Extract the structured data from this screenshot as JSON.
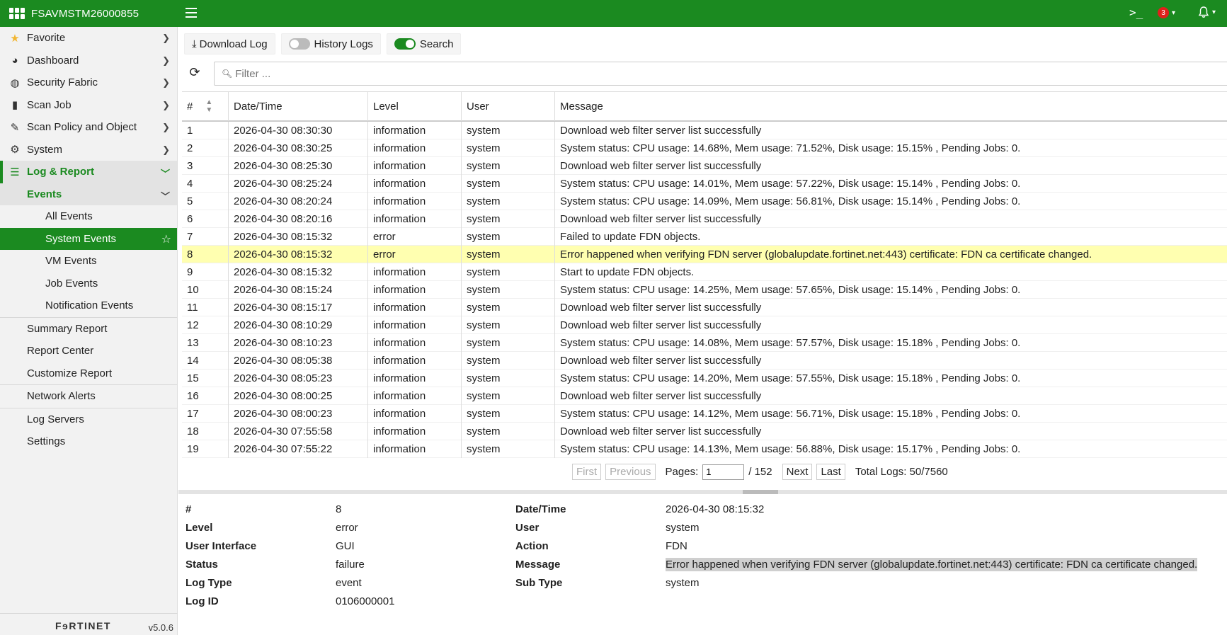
{
  "app": {
    "hostname": "FSAVMSTM26000855",
    "version": "v5.0.6",
    "brand": "FɘRTINET",
    "alert_count": "3",
    "accent": "#1b8a20"
  },
  "sidebar": {
    "items": [
      {
        "label": "Favorite",
        "icon": "star-icon"
      },
      {
        "label": "Dashboard",
        "icon": "dashboard-icon"
      },
      {
        "label": "Security Fabric",
        "icon": "fabric-icon"
      },
      {
        "label": "Scan Job",
        "icon": "file-icon"
      },
      {
        "label": "Scan Policy and Object",
        "icon": "edit-icon"
      },
      {
        "label": "System",
        "icon": "gear-icon"
      },
      {
        "label": "Log & Report",
        "icon": "chart-icon"
      }
    ],
    "events_label": "Events",
    "events_items": [
      "All Events",
      "System Events",
      "VM Events",
      "Job Events",
      "Notification Events"
    ],
    "report_items": [
      "Summary Report",
      "Report Center",
      "Customize Report"
    ],
    "network_alerts": "Network Alerts",
    "bottom_items": [
      "Log Servers",
      "Settings"
    ]
  },
  "toolbar": {
    "download": "Download Log",
    "history": "History Logs",
    "search": "Search"
  },
  "filter": {
    "placeholder": "Filter ..."
  },
  "table": {
    "headers": [
      "#",
      "Date/Time",
      "Level",
      "User",
      "Message"
    ],
    "rows": [
      [
        "1",
        "2026-04-30 08:30:30",
        "information",
        "system",
        "Download web filter server list successfully"
      ],
      [
        "2",
        "2026-04-30 08:30:25",
        "information",
        "system",
        "System status: CPU usage: 14.68%, Mem usage: 71.52%, Disk usage: 15.15% , Pending Jobs: 0."
      ],
      [
        "3",
        "2026-04-30 08:25:30",
        "information",
        "system",
        "Download web filter server list successfully"
      ],
      [
        "4",
        "2026-04-30 08:25:24",
        "information",
        "system",
        "System status: CPU usage: 14.01%, Mem usage: 57.22%, Disk usage: 15.14% , Pending Jobs: 0."
      ],
      [
        "5",
        "2026-04-30 08:20:24",
        "information",
        "system",
        "System status: CPU usage: 14.09%, Mem usage: 56.81%, Disk usage: 15.14% , Pending Jobs: 0."
      ],
      [
        "6",
        "2026-04-30 08:20:16",
        "information",
        "system",
        "Download web filter server list successfully"
      ],
      [
        "7",
        "2026-04-30 08:15:32",
        "error",
        "system",
        "Failed to update FDN objects."
      ],
      [
        "8",
        "2026-04-30 08:15:32",
        "error",
        "system",
        "Error happened when verifying FDN server (globalupdate.fortinet.net:443) certificate: FDN ca certificate changed."
      ],
      [
        "9",
        "2026-04-30 08:15:32",
        "information",
        "system",
        "Start to update FDN objects."
      ],
      [
        "10",
        "2026-04-30 08:15:24",
        "information",
        "system",
        "System status: CPU usage: 14.25%, Mem usage: 57.65%, Disk usage: 15.14% , Pending Jobs: 0."
      ],
      [
        "11",
        "2026-04-30 08:15:17",
        "information",
        "system",
        "Download web filter server list successfully"
      ],
      [
        "12",
        "2026-04-30 08:10:29",
        "information",
        "system",
        "Download web filter server list successfully"
      ],
      [
        "13",
        "2026-04-30 08:10:23",
        "information",
        "system",
        "System status: CPU usage: 14.08%, Mem usage: 57.57%, Disk usage: 15.18% , Pending Jobs: 0."
      ],
      [
        "14",
        "2026-04-30 08:05:38",
        "information",
        "system",
        "Download web filter server list successfully"
      ],
      [
        "15",
        "2026-04-30 08:05:23",
        "information",
        "system",
        "System status: CPU usage: 14.20%, Mem usage: 57.55%, Disk usage: 15.18% , Pending Jobs: 0."
      ],
      [
        "16",
        "2026-04-30 08:00:25",
        "information",
        "system",
        "Download web filter server list successfully"
      ],
      [
        "17",
        "2026-04-30 08:00:23",
        "information",
        "system",
        "System status: CPU usage: 14.12%, Mem usage: 56.71%, Disk usage: 15.18% , Pending Jobs: 0."
      ],
      [
        "18",
        "2026-04-30 07:55:58",
        "information",
        "system",
        "Download web filter server list successfully"
      ],
      [
        "19",
        "2026-04-30 07:55:22",
        "information",
        "system",
        "System status: CPU usage: 14.13%, Mem usage: 56.88%, Disk usage: 15.17% , Pending Jobs: 0."
      ]
    ],
    "selected_index": 7
  },
  "pager": {
    "first": "First",
    "previous": "Previous",
    "pages_label": "Pages:",
    "page_value": "1",
    "page_total": "/ 152",
    "next": "Next",
    "last": "Last",
    "total": "Total Logs: 50/7560"
  },
  "details": {
    "rows": [
      {
        "k1": "#",
        "v1": "8",
        "k2": "Date/Time",
        "v2": "2026-04-30 08:15:32"
      },
      {
        "k1": "Level",
        "v1": "error",
        "k2": "User",
        "v2": "system"
      },
      {
        "k1": "User Interface",
        "v1": "GUI",
        "k2": "Action",
        "v2": "FDN"
      },
      {
        "k1": "Status",
        "v1": "failure",
        "k2": "Message",
        "v2": "Error happened when verifying FDN server (globalupdate.fortinet.net:443) certificate: FDN ca certificate changed."
      },
      {
        "k1": "Log Type",
        "v1": "event",
        "k2": "Sub Type",
        "v2": "system"
      },
      {
        "k1": "Log ID",
        "v1": "0106000001",
        "k2": "",
        "v2": ""
      }
    ]
  }
}
